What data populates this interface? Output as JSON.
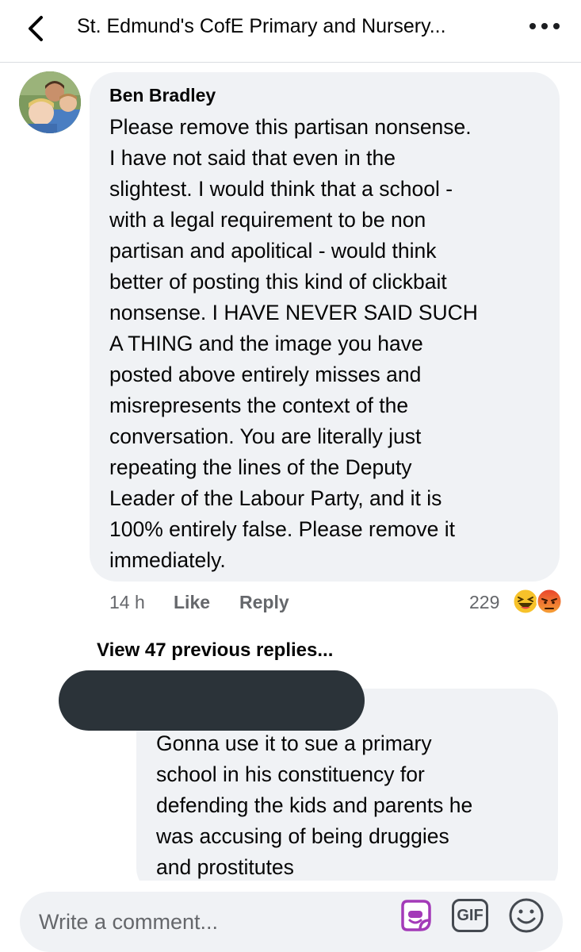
{
  "header": {
    "title": "St. Edmund's CofE Primary and Nursery...",
    "back_icon": "chevron-left-icon",
    "more_icon": "more-horizontal-icon"
  },
  "comment": {
    "author": "Ben Bradley",
    "text": "Please remove this partisan nonsense.\nI have not said that even in the\nslightest. I would think that a school -\nwith a legal requirement to be non\npartisan and apolitical - would think\nbetter of posting this kind of clickbait\nnonsense. I HAVE NEVER SAID SUCH\nA THING and the image you have\nposted above entirely misses and\nmisrepresents the context of the\nconversation. You are literally just\nrepeating the lines of the Deputy\nLeader of the Labour Party, and it is\n100% entirely false. Please remove it\nimmediately.",
    "time": "14 h",
    "like_label": "Like",
    "reply_label": "Reply",
    "reaction_count": "229",
    "reactions": [
      "laughing-emoji-icon",
      "angry-emoji-icon"
    ]
  },
  "replies": {
    "view_previous_label": "View 47 previous replies..."
  },
  "reply": {
    "text": "Gonna use it to sue a primary\nschool in his constituency for\ndefending the kids and parents he\nwas accusing of being druggies\nand prostitutes"
  },
  "composer": {
    "placeholder": "Write a comment...",
    "sticker_icon": "sticker-icon",
    "gif_label": "GIF",
    "emoji_icon": "smiley-icon"
  },
  "colors": {
    "bubble": "#f0f2f5",
    "meta_text": "#65676b",
    "redaction": "#2b3339",
    "sticker_accent": "#a33ab8"
  }
}
